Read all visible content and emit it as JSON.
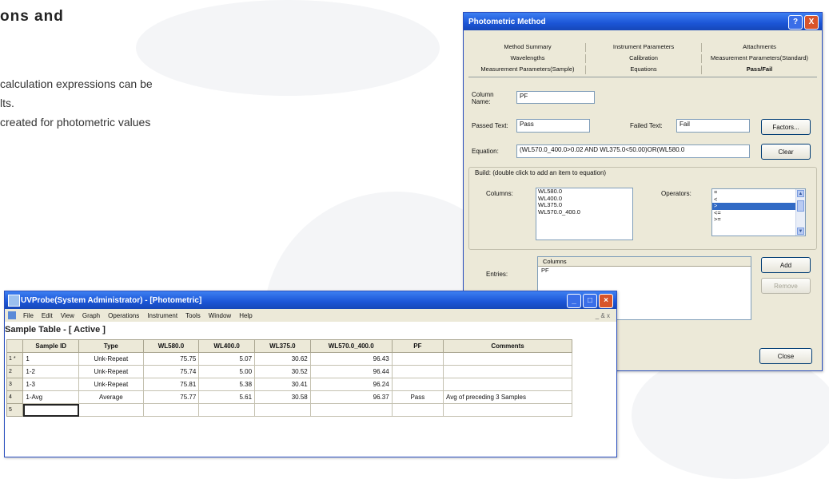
{
  "document": {
    "heading": "ons and",
    "lines": [
      "calculation expressions can be",
      "lts.",
      "created for photometric values"
    ]
  },
  "dialog": {
    "title": "Photometric Method",
    "title_help": "?",
    "title_close": "X",
    "tabs_row1": [
      "Method Summary",
      "Instrument Parameters",
      "Attachments"
    ],
    "tabs_row2": [
      "Wavelengths",
      "Calibration",
      "Measurement Parameters(Standard)"
    ],
    "tabs_row3": [
      "Measurement Parameters(Sample)",
      "Equations",
      "Pass/Fail"
    ],
    "active_tab": "Pass/Fail",
    "column_name_label": "Column Name:",
    "column_name_value": "PF",
    "passed_text_label": "Passed Text:",
    "passed_text_value": "Pass",
    "failed_text_label": "Failed Text:",
    "failed_text_value": "Fail",
    "factors_button": "Factors...",
    "equation_label": "Equation:",
    "equation_value": "(WL570.0_400.0>0.02 AND WL375.0<50.00)OR(WL580.0",
    "clear_button": "Clear",
    "build_label": "Build: (double click to add an item to equation)",
    "columns_label": "Columns:",
    "columns_items": [
      "WL580.0",
      "WL400.0",
      "WL375.0",
      "WL570.0_400.0"
    ],
    "operators_label": "Operators:",
    "operators_items": [
      "=",
      "<",
      ">",
      "<=",
      ">="
    ],
    "operators_selected": 2,
    "entries_label": "Entries:",
    "entries_header": "Columns",
    "entries_items": [
      "PF"
    ],
    "add_button": "Add",
    "remove_button": "Remove",
    "close_button": "Close"
  },
  "tablewin": {
    "title": "UVProbe(System Administrator) - [Photometric]",
    "menu": [
      "File",
      "Edit",
      "View",
      "Graph",
      "Operations",
      "Instrument",
      "Tools",
      "Window",
      "Help"
    ],
    "inner_controls": "_ & x",
    "sheet_title": "Sample Table - [ Active ]",
    "columns": [
      "Sample ID",
      "Type",
      "WL580.0",
      "WL400.0",
      "WL375.0",
      "WL570.0_400.0",
      "PF",
      "Comments"
    ],
    "rows": [
      {
        "rh": "1 *",
        "sample_id": "1",
        "type": "Unk-Repeat",
        "wl580": "75.75",
        "wl400": "5.07",
        "wl375": "30.62",
        "wl570_400": "96.43",
        "pf": "",
        "comments": ""
      },
      {
        "rh": "2",
        "sample_id": "1-2",
        "type": "Unk-Repeat",
        "wl580": "75.74",
        "wl400": "5.00",
        "wl375": "30.52",
        "wl570_400": "96.44",
        "pf": "",
        "comments": ""
      },
      {
        "rh": "3",
        "sample_id": "1-3",
        "type": "Unk-Repeat",
        "wl580": "75.81",
        "wl400": "5.38",
        "wl375": "30.41",
        "wl570_400": "96.24",
        "pf": "",
        "comments": ""
      },
      {
        "rh": "4",
        "sample_id": "1-Avg",
        "type": "Average",
        "wl580": "75.77",
        "wl400": "5.61",
        "wl375": "30.58",
        "wl570_400": "96.37",
        "pf": "Pass",
        "comments": "Avg of preceding 3 Samples"
      },
      {
        "rh": "5",
        "sample_id": "",
        "type": "",
        "wl580": "",
        "wl400": "",
        "wl375": "",
        "wl570_400": "",
        "pf": "",
        "comments": ""
      }
    ]
  },
  "colors": {
    "titlebar": "#1b55d6",
    "window_face": "#ece9d8",
    "selection": "#316ac5"
  }
}
